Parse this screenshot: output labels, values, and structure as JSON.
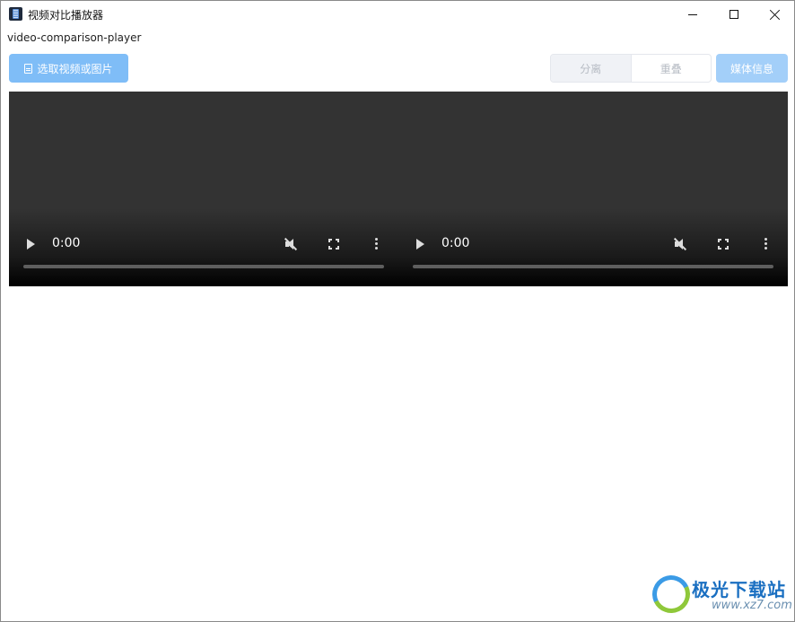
{
  "window": {
    "title": "视频对比播放器",
    "app_name": "video-comparison-player"
  },
  "toolbar": {
    "select_label": "选取视频或图片",
    "mode_options": [
      "分离",
      "重叠"
    ],
    "mode_selected": "分离",
    "media_info_label": "媒体信息"
  },
  "players": [
    {
      "time": "0:00",
      "muted": true
    },
    {
      "time": "0:00",
      "muted": true
    }
  ],
  "watermark": {
    "text": "极光下载站",
    "url": "www.xz7.com"
  },
  "colors": {
    "primary_button": "#7fbdf7",
    "info_button": "#a3cff9",
    "video_bg": "#333333"
  }
}
